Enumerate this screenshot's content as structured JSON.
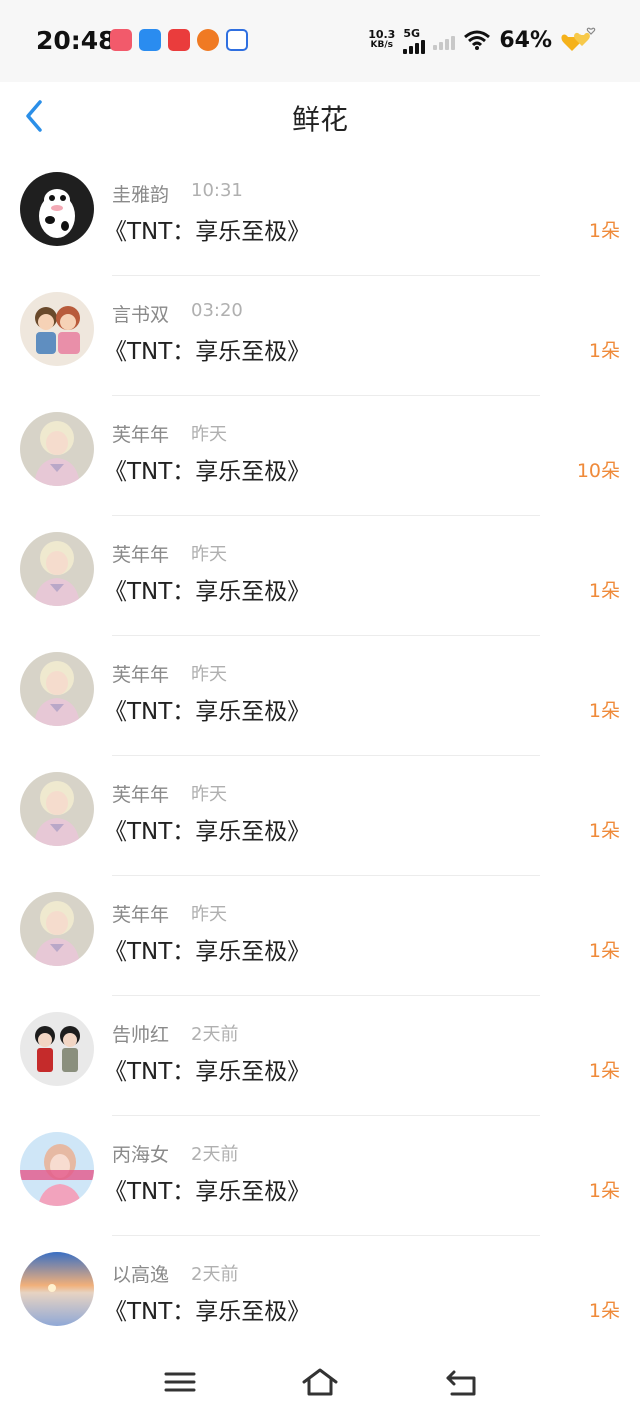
{
  "status": {
    "time": "20:48",
    "net_speed_top": "10.3",
    "net_speed_unit": "KB/s",
    "network": "5G",
    "battery": "64%",
    "app_icons": [
      "douyin-icon",
      "navigation-icon",
      "game-icon",
      "halloween-icon",
      "baidu-icon"
    ]
  },
  "header": {
    "title": "鲜花",
    "back_icon": "chevron-left-icon"
  },
  "flowers": [
    {
      "name": "圭雅韵",
      "time": "10:31",
      "work": "《TNT：享乐至极》",
      "count": "1朵",
      "avatar": "cow-cartoon"
    },
    {
      "name": "言书双",
      "time": "03:20",
      "work": "《TNT：享乐至极》",
      "count": "1朵",
      "avatar": "couple-cartoon"
    },
    {
      "name": "芙年年",
      "time": "昨天",
      "work": "《TNT：享乐至极》",
      "count": "10朵",
      "avatar": "blonde-girl"
    },
    {
      "name": "芙年年",
      "time": "昨天",
      "work": "《TNT：享乐至极》",
      "count": "1朵",
      "avatar": "blonde-girl"
    },
    {
      "name": "芙年年",
      "time": "昨天",
      "work": "《TNT：享乐至极》",
      "count": "1朵",
      "avatar": "blonde-girl"
    },
    {
      "name": "芙年年",
      "time": "昨天",
      "work": "《TNT：享乐至极》",
      "count": "1朵",
      "avatar": "blonde-girl"
    },
    {
      "name": "芙年年",
      "time": "昨天",
      "work": "《TNT：享乐至极》",
      "count": "1朵",
      "avatar": "blonde-girl"
    },
    {
      "name": "告帅红",
      "time": "2天前",
      "work": "《TNT：享乐至极》",
      "count": "1朵",
      "avatar": "dolls"
    },
    {
      "name": "丙海女",
      "time": "2天前",
      "work": "《TNT：享乐至极》",
      "count": "1朵",
      "avatar": "pink-girl"
    },
    {
      "name": "以高逸",
      "time": "2天前",
      "work": "《TNT：享乐至极》",
      "count": "1朵",
      "avatar": "sunset-sea"
    }
  ],
  "navbar": {
    "icons": [
      "menu-icon",
      "home-icon",
      "back-icon"
    ]
  },
  "colors": {
    "accent": "#2b8fe8",
    "count": "#ef8a3a",
    "name": "#8a8a8a",
    "time": "#b0b0b0"
  }
}
